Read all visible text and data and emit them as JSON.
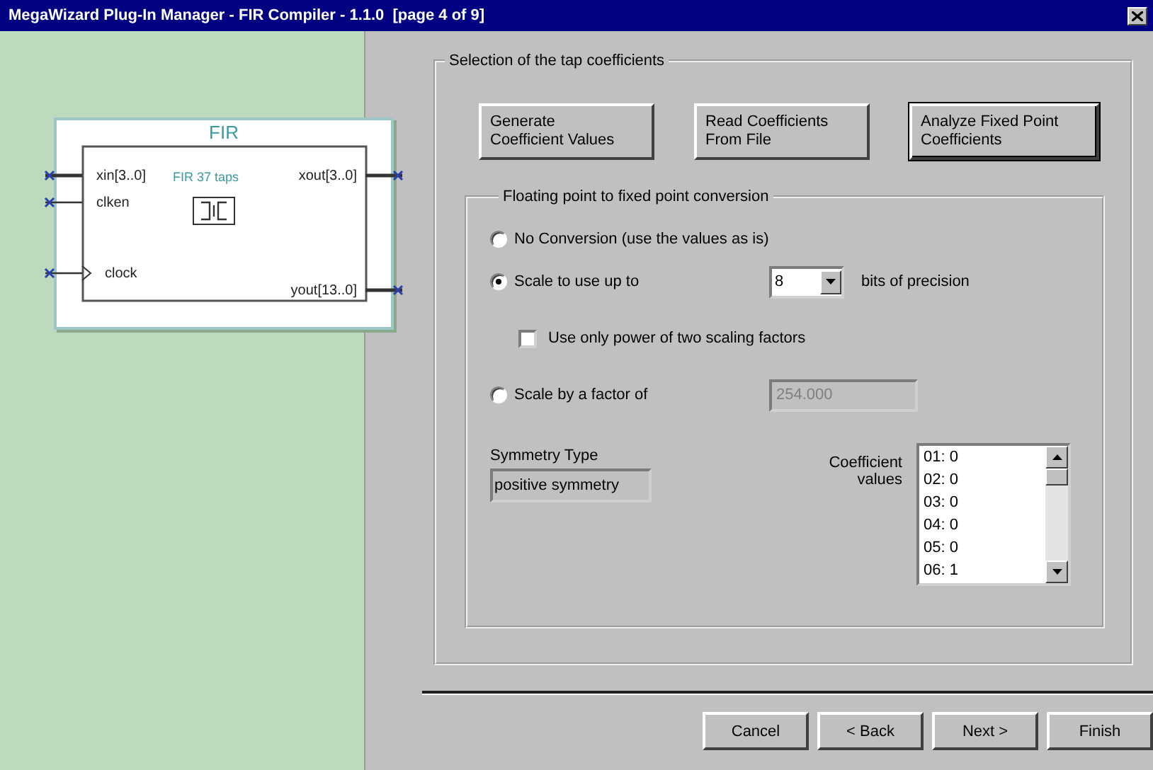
{
  "window": {
    "title": "MegaWizard Plug-In Manager - FIR Compiler - 1.1.0  [page 4 of 9]"
  },
  "diagram": {
    "title": "FIR",
    "block_label": "FIR 37 taps",
    "inputs": [
      {
        "name": "xin[3..0]",
        "kind": "bus"
      },
      {
        "name": "clken",
        "kind": "wire"
      },
      {
        "name": "clock",
        "kind": "clock"
      }
    ],
    "outputs": [
      {
        "name": "xout[3..0]",
        "kind": "bus"
      },
      {
        "name": "yout[13..0]",
        "kind": "bus"
      }
    ]
  },
  "tap_group": {
    "title": "Selection of the tap coefficients",
    "buttons": [
      {
        "label": "Generate\nCoefficient Values",
        "focused": false
      },
      {
        "label": "Read Coefficients\nFrom File",
        "focused": false
      },
      {
        "label": "Analyze Fixed Point\nCoefficients",
        "focused": true
      }
    ]
  },
  "conversion": {
    "title": "Floating point to fixed point conversion",
    "options": [
      {
        "kind": "radio",
        "label": "No Conversion (use the values as is)",
        "selected": false
      },
      {
        "kind": "radio_select",
        "label": "Scale to use up to",
        "selected": true,
        "select_value": "8",
        "suffix": "bits of precision"
      },
      {
        "kind": "checkbox",
        "label": "Use only power of two scaling factors",
        "checked": false
      },
      {
        "kind": "radio_field",
        "label": "Scale by a factor of",
        "selected": false,
        "field_value": "254.000",
        "field_disabled": true
      }
    ],
    "symmetry": {
      "label": "Symmetry Type",
      "value": "positive symmetry"
    },
    "coefficients": {
      "label": "Coefficient values",
      "items": [
        "01: 0",
        "02: 0",
        "03: 0",
        "04: 0",
        "05: 0",
        "06: 1"
      ]
    }
  },
  "buttons": [
    {
      "label": "Cancel"
    },
    {
      "label": "< Back"
    },
    {
      "label": "Next >"
    },
    {
      "label": "Finish"
    }
  ]
}
